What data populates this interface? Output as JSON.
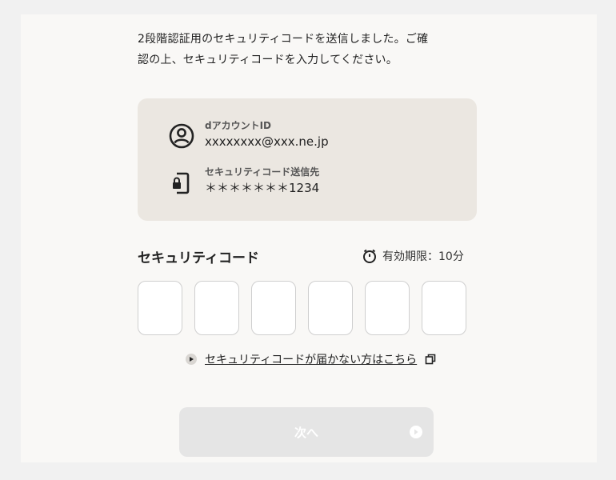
{
  "intro": {
    "line1": "2段階認証用のセキュリティコードを送信しました。ご確",
    "line2": "認の上、セキュリティコードを入力してください。"
  },
  "account": {
    "label": "dアカウントID",
    "value": "xxxxxxxx@xxx.ne.jp",
    "icon": "user-circle-icon"
  },
  "destination": {
    "label": "セキュリティコード送信先",
    "value": "＊＊＊＊＊＊＊1234",
    "icon": "mobile-lock-icon"
  },
  "code": {
    "title": "セキュリティコード",
    "expiry": "有効期限：10分",
    "digits": [
      "",
      "",
      "",
      "",
      "",
      ""
    ]
  },
  "help": {
    "link_text": "セキュリティコードが届かない方はこちら"
  },
  "next_button": {
    "label": "次へ",
    "state": "disabled"
  },
  "colors": {
    "page_bg": "#f9f8f6",
    "card_bg": "#ebe7e1",
    "button_disabled_bg": "#e5e5e5",
    "text": "#222222"
  }
}
